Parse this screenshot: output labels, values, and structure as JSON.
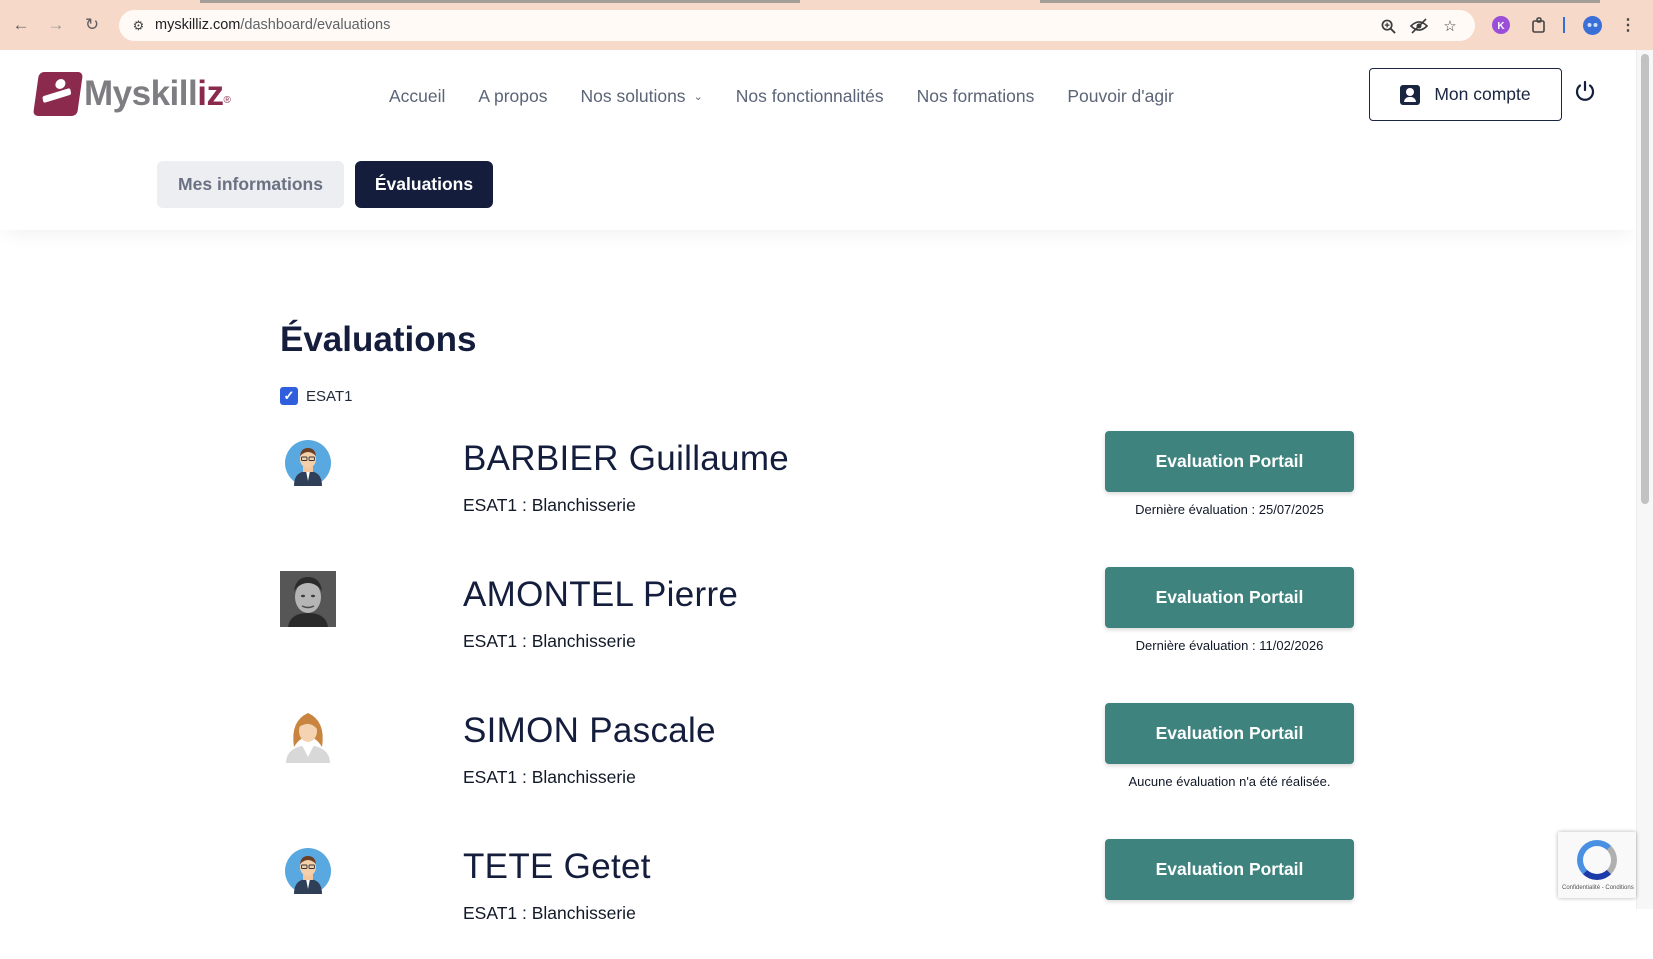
{
  "browser": {
    "url_domain": "myskilliz.com",
    "url_path": "/dashboard/evaluations"
  },
  "header": {
    "logo_text_main": "Myskill",
    "logo_text_accent": "iz",
    "logo_reg": "®",
    "nav": {
      "home": "Accueil",
      "about": "A propos",
      "solutions": "Nos solutions",
      "features": "Nos fonctionnalités",
      "trainings": "Nos formations",
      "empowerment": "Pouvoir d'agir"
    },
    "account_label": "Mon compte"
  },
  "tabs": {
    "info": "Mes informations",
    "evaluations": "Évaluations"
  },
  "main": {
    "title": "Évaluations",
    "filter_label": "ESAT1",
    "filter_checked": true,
    "people": [
      {
        "name": "BARBIER Guillaume",
        "group": "ESAT1 : Blanchisserie",
        "button": "Evaluation Portail",
        "status": "Dernière évaluation : 25/07/2025",
        "avatar": "man-cartoon-avatar"
      },
      {
        "name": "AMONTEL Pierre",
        "group": "ESAT1 : Blanchisserie",
        "button": "Evaluation Portail",
        "status": "Dernière évaluation : 11/02/2026",
        "avatar": "photo-avatar"
      },
      {
        "name": "SIMON Pascale",
        "group": "ESAT1 : Blanchisserie",
        "button": "Evaluation Portail",
        "status": "Aucune évaluation n'a été réalisée.",
        "avatar": "woman-avatar"
      },
      {
        "name": "TETE Getet",
        "group": "ESAT1 : Blanchisserie",
        "button": "Evaluation Portail",
        "status": "",
        "avatar": "man-cartoon-avatar"
      }
    ]
  },
  "recaptcha": {
    "text": "Confidentialité - Conditions"
  },
  "colors": {
    "brand": "#8b2a4d",
    "navy": "#141e3c",
    "teal_button": "#3e837d",
    "checkbox": "#2f5fdc"
  }
}
